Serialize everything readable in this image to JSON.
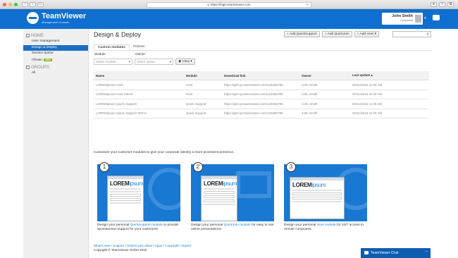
{
  "browser": {
    "url": "https://login.teamviewer.com"
  },
  "header": {
    "brand": "TeamViewer",
    "subtitle": "Management Console",
    "user_name": "John Smith",
    "company": "Corporate"
  },
  "sidebar": {
    "home_label": "HOME",
    "items": [
      {
        "label": "User management"
      },
      {
        "label": "Design & Deploy"
      },
      {
        "label": "Service queue"
      },
      {
        "label": "ITbrain",
        "badge": "NEW"
      }
    ],
    "groups_label": "GROUPS",
    "group_items": [
      {
        "label": "All"
      }
    ]
  },
  "main": {
    "title": "Design & Deploy",
    "buttons": {
      "add_quicksupport": "+ Add QuickSupport",
      "add_quickjoin": "+ Add QuickJoin",
      "add_host": "+ Add Host"
    },
    "tabs": [
      {
        "label": "Custom modules"
      },
      {
        "label": "Policies"
      }
    ],
    "filters": {
      "module_label": "Module",
      "module_placeholder": "Select module...",
      "owner_label": "Owner",
      "owner_placeholder": "Select owner...",
      "view_label": "View"
    },
    "table": {
      "headers": [
        "Name",
        "Module",
        "Download link",
        "Owner",
        "Last update"
      ],
      "rows": [
        [
          "LOREMipsum Host",
          "Host",
          "https://get-qs.teamviewer.com/123456789",
          "John Smith",
          "02/11/2016 11:00 AM"
        ],
        [
          "LOREMipsum Host XMAS",
          "Host",
          "https://get-qs.teamviewer.com/123456789",
          "John Smith",
          "02/11/2016 11:00 AM"
        ],
        [
          "LOREMipsum Quick Support",
          "Quick Support",
          "https://get-qs.teamviewer.com/123456789",
          "John Smith",
          "02/11/2016 11:00 AM"
        ],
        [
          "LOREMipsum Quick Support XMAS",
          "Quick Support",
          "https://get-qs.teamviewer.com/123456789",
          "John Smith",
          "02/11/2016 11:00 AM"
        ]
      ]
    },
    "customize_text": "Customize your customer modules to give your corporate identity a more prominent presence.",
    "cards": [
      {
        "num": "1",
        "logo_a": "LOREM",
        "logo_b": "ipsum",
        "pre": "Design your personal ",
        "link": "QuickSupport module",
        "post": " to provide spontaneous support for your customers."
      },
      {
        "num": "2",
        "logo_a": "LOREM",
        "logo_b": "ipsum",
        "pre": "Design your personal ",
        "link": "QuickJoin module",
        "post": " for easy to use online presentations."
      },
      {
        "num": "3",
        "logo_a": "LOREM",
        "logo_b": "ipsum",
        "pre": "Design your personal ",
        "link": "Host module",
        "post": " for 24/7 access to remote computers."
      }
    ]
  },
  "footer": {
    "links": "What's new • Support • Submit your ideas • Apps • Copyright • Imprint",
    "copyright": "Copyright © TeamViewer GmbH 2016"
  },
  "chat": {
    "label": "TeamViewer Chat"
  },
  "colors": {
    "brand": "#0e6fd0",
    "active": "#1a6fc6",
    "badge": "#7ab800"
  }
}
